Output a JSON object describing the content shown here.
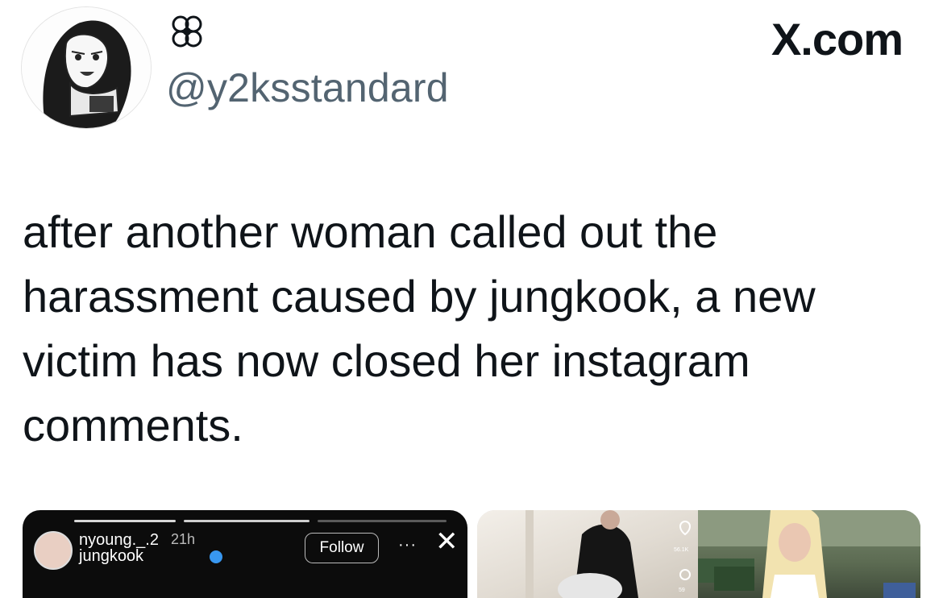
{
  "header": {
    "handle": "@y2ksstandard",
    "brand": "X.com",
    "display_name_icon": "flower-icon"
  },
  "tweet": {
    "text": "after another woman called out the harassment caused by jungkook, a new victim has now closed her instagram comments."
  },
  "media": {
    "left": {
      "username": "nyoung._.2",
      "time": "21h",
      "subtitle": "jungkook",
      "follow_label": "Follow",
      "more_label": "···",
      "close_label": "✕"
    },
    "right": {
      "like_count": "56.1K",
      "comment_count": "59"
    }
  },
  "colors": {
    "text": "#0f1419",
    "secondary": "#536471",
    "verified": "#3897f0"
  }
}
